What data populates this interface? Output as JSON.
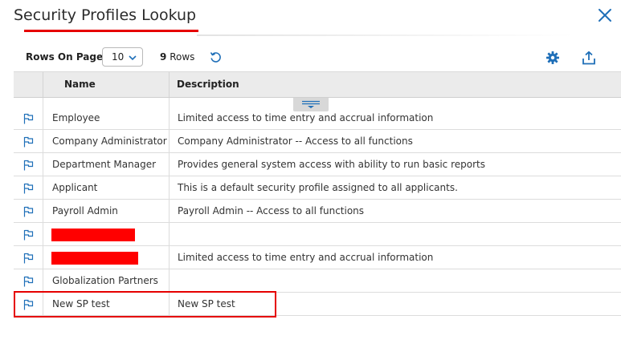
{
  "dialog": {
    "title": "Security Profiles Lookup"
  },
  "toolbar": {
    "rows_on_page_label": "Rows On Page",
    "rows_on_page_value": "10",
    "row_count": "9",
    "row_count_label": "Rows"
  },
  "table": {
    "columns": {
      "name": "Name",
      "description": "Description"
    },
    "rows": [
      {
        "name": "Employee",
        "description": "Limited access to time entry and accrual information"
      },
      {
        "name": "Company Administrator",
        "description": "Company Administrator -- Access to all functions"
      },
      {
        "name": "Department Manager",
        "description": "Provides general system access with ability to run basic reports"
      },
      {
        "name": "Applicant",
        "description": "This is a default security profile assigned to all applicants."
      },
      {
        "name": "Payroll Admin",
        "description": "Payroll Admin -- Access to all functions"
      },
      {
        "name": "",
        "description": ""
      },
      {
        "name": "",
        "description": "Limited access to time entry and accrual information"
      },
      {
        "name": "Globalization Partners",
        "description": ""
      },
      {
        "name": "New SP test",
        "description": "New SP test"
      }
    ]
  },
  "colors": {
    "accent_blue": "#1f6fb8",
    "annotation_red": "#e60000",
    "redaction_red": "#ff0000",
    "header_bg": "#ebebeb"
  },
  "icons": {
    "close": "close-icon",
    "refresh": "refresh-icon",
    "settings": "gear-icon",
    "export": "export-icon",
    "row_select": "flag-icon",
    "resize": "resize-handle-icon"
  }
}
